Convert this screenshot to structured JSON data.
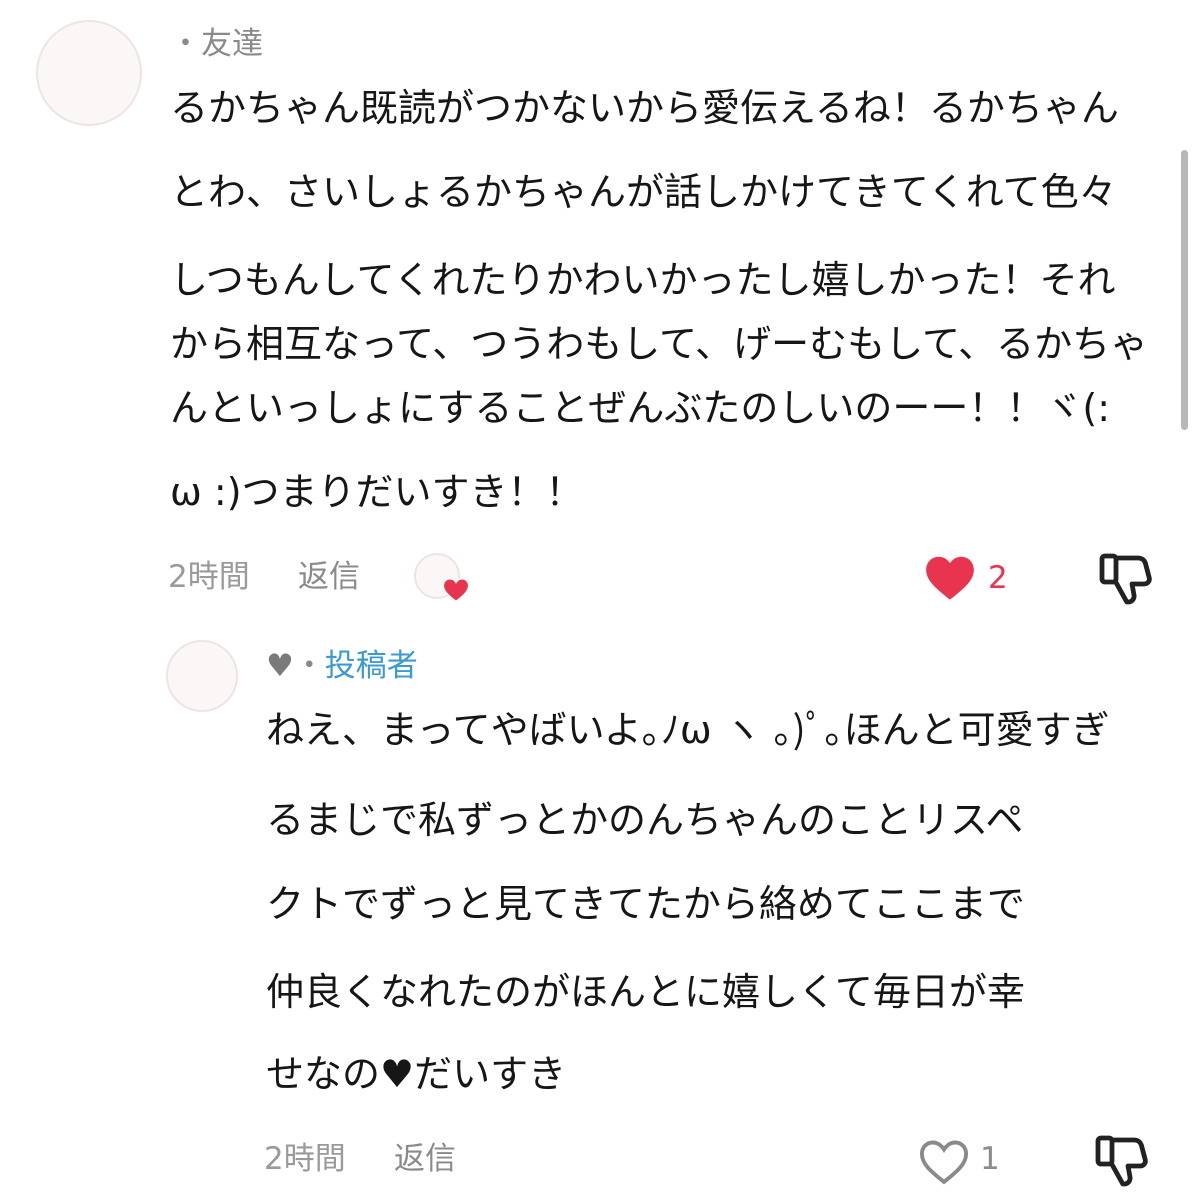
{
  "comment": {
    "meta": "・友達",
    "lines": [
      "るかちゃん既読がつかないから愛伝えるね！るかちゃん",
      "とわ、さいしょるかちゃんが話しかけてきてくれて色々",
      "しつもんしてくれたりかわいかったし嬉しかった！それ",
      "から相互なって、つうわもして、げーむもして、るかちゃ",
      "んといっしょにすることぜんぶたのしいのーー！！ヾ(:",
      "ω :)つまりだいすき！！"
    ],
    "time": "2時間",
    "reply_label": "返信",
    "likes": "2",
    "liked": true,
    "colors": {
      "like": "#e8344e",
      "meta": "#8a8a8a"
    }
  },
  "reply": {
    "heart": "♥",
    "separator": "・",
    "role": "投稿者",
    "lines": [
      "ねえ、まってやばいよ｡ﾉω ヽ ｡)ﾟ｡ほんと可愛すぎ",
      "るまじで私ずっとかのんちゃんのことリスペ",
      "クトでずっと見てきてたから絡めてここまで",
      "仲良くなれたのがほんとに嬉しくて毎日が幸",
      "せなの♥だいすき"
    ],
    "time": "2時間",
    "reply_label": "返信",
    "likes": "1",
    "liked": false,
    "colors": {
      "role": "#3b9bd0"
    }
  },
  "icons": {
    "avatar": "avatar",
    "reactor_heart": "heart-icon",
    "like": "heart-icon",
    "dislike": "thumbs-down-icon"
  }
}
